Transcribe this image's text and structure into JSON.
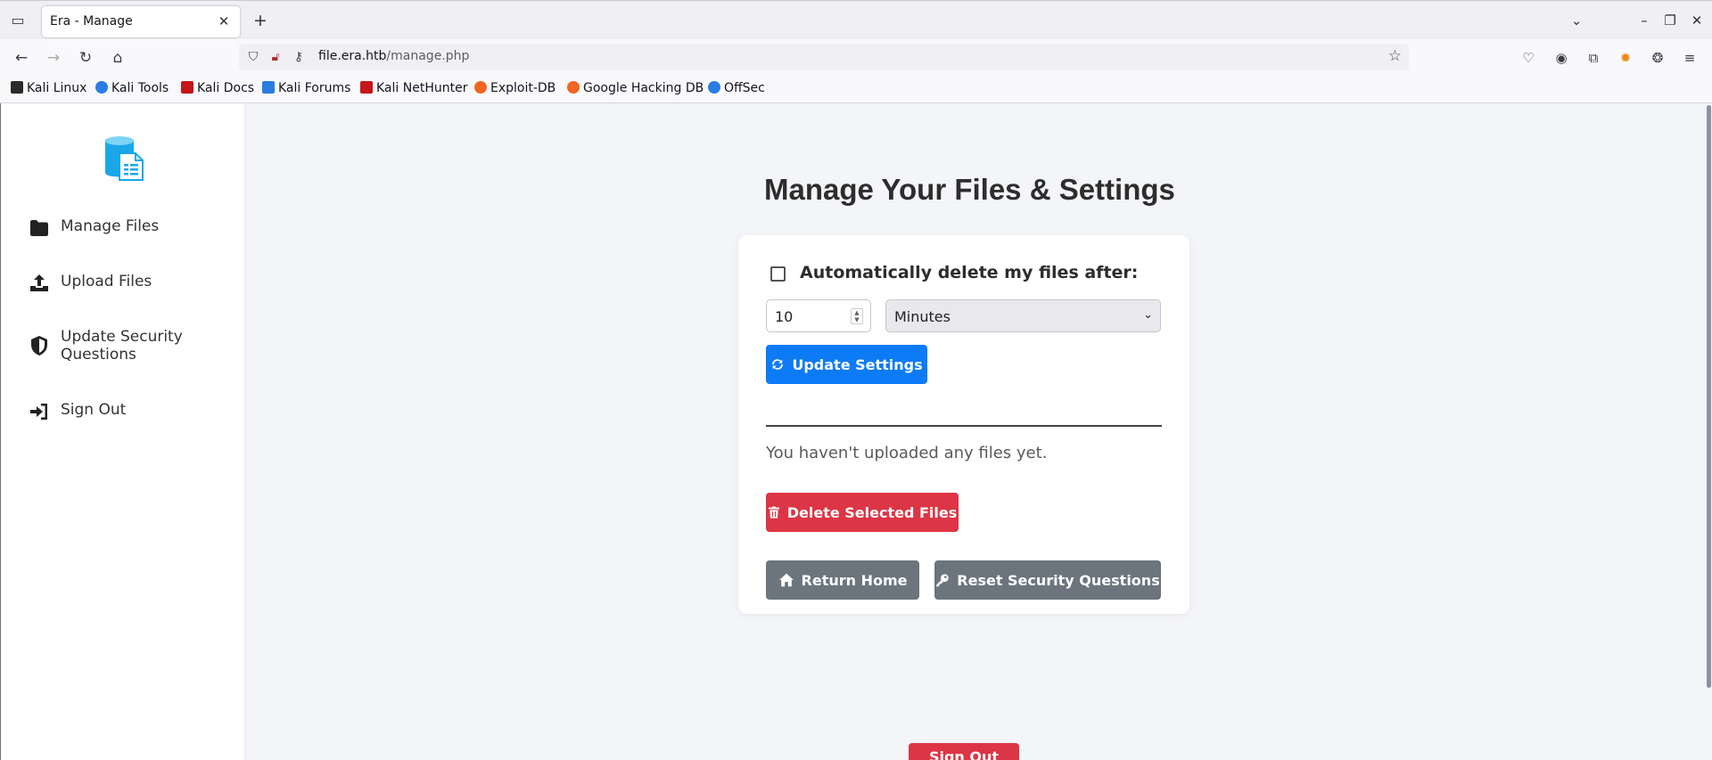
{
  "browser": {
    "tab_title": "Era - Manage",
    "url_host": "file.era.htb",
    "url_path": "/manage.php"
  },
  "bookmarks": [
    {
      "label": "Kali Linux",
      "color": "#1c1c1c"
    },
    {
      "label": "Kali Tools",
      "color": "#2a7de1"
    },
    {
      "label": "Kali Docs",
      "color": "#c4161c"
    },
    {
      "label": "Kali Forums",
      "color": "#2a7de1"
    },
    {
      "label": "Kali NetHunter",
      "color": "#c4161c"
    },
    {
      "label": "Exploit-DB",
      "color": "#f26522"
    },
    {
      "label": "Google Hacking DB",
      "color": "#f26522"
    },
    {
      "label": "OffSec",
      "color": "#2a7de1"
    }
  ],
  "sidebar": {
    "items": [
      {
        "label": "Manage Files",
        "icon": "folder-icon"
      },
      {
        "label": "Upload Files",
        "icon": "upload-icon"
      },
      {
        "label": "Update Security Questions",
        "icon": "shield-icon"
      },
      {
        "label": "Sign Out",
        "icon": "sign-out-icon"
      }
    ]
  },
  "main": {
    "title": "Manage Your Files & Settings",
    "auto_delete_label": "Automatically delete my files after:",
    "auto_delete_checked": false,
    "amount_value": "10",
    "unit_value": "Minutes",
    "update_button": "Update Settings",
    "empty_message": "You haven't uploaded any files yet.",
    "delete_button": "Delete Selected Files",
    "home_button": "Return Home",
    "reset_button": "Reset Security Questions",
    "signout_button": "Sign Out"
  },
  "colors": {
    "primary": "#0d7bf5",
    "danger": "#dc3545",
    "secondary": "#6c757d",
    "logo": "#1aa7e8"
  }
}
